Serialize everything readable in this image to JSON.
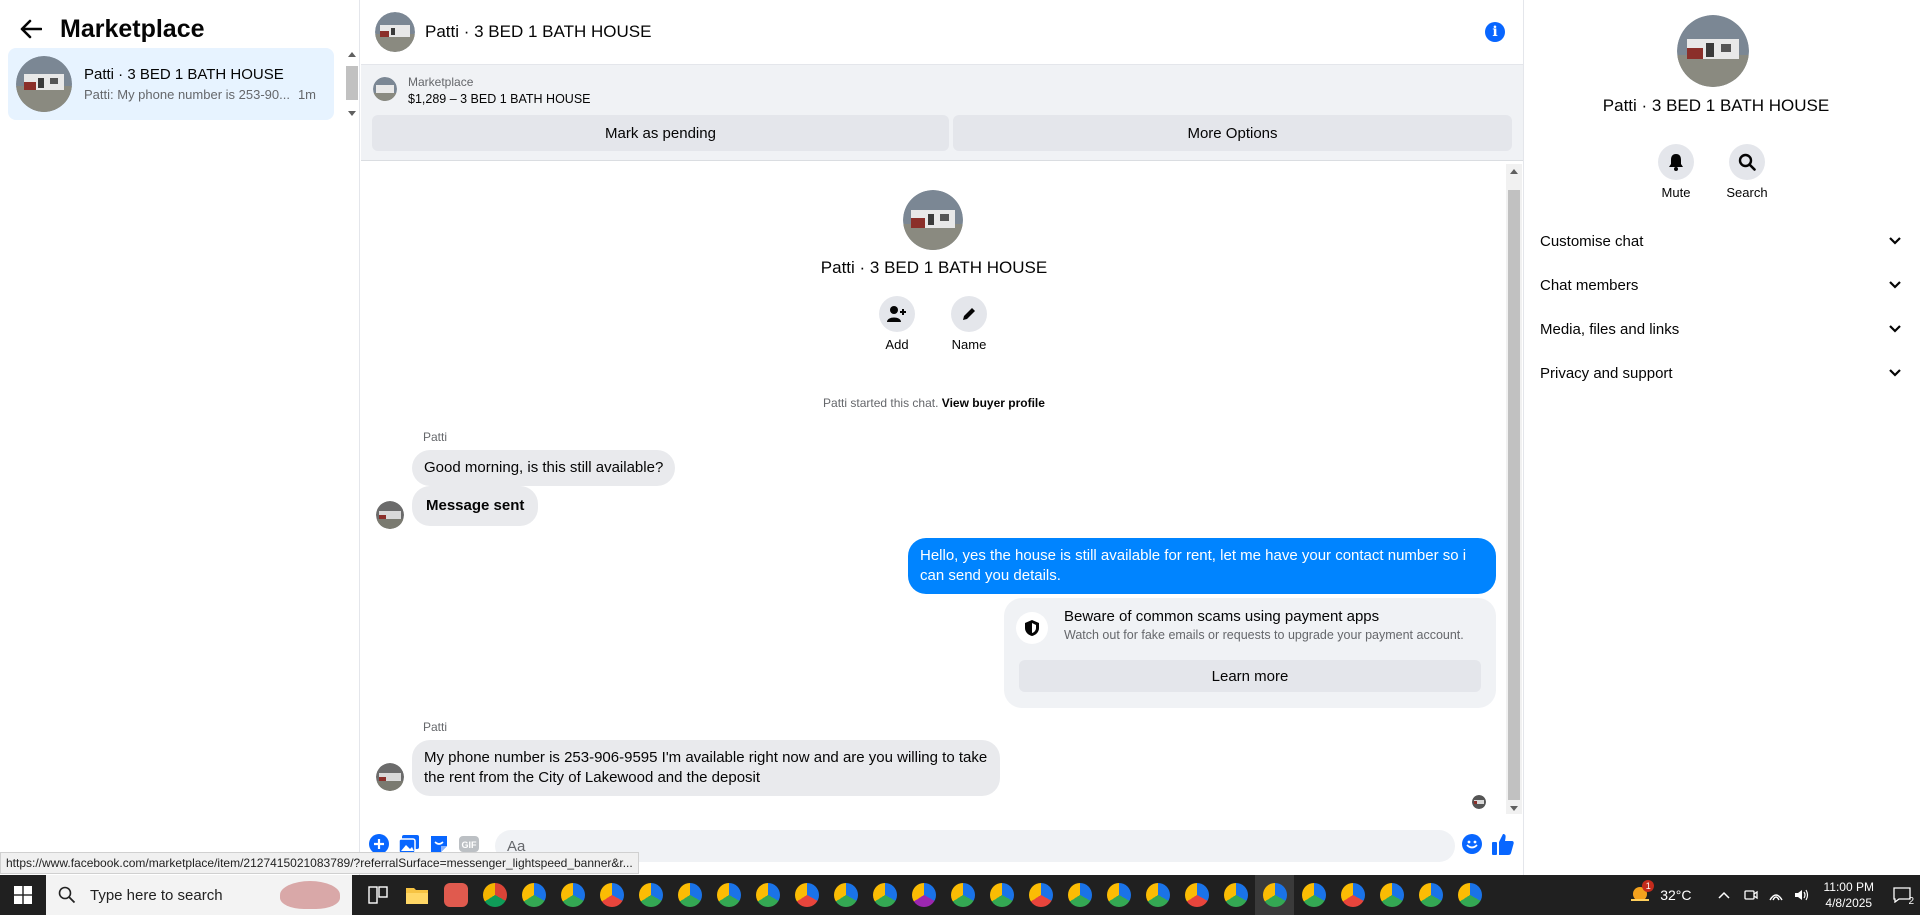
{
  "sidebar": {
    "title": "Marketplace",
    "conversation": {
      "name": "Patti · 3 BED 1 BATH HOUSE",
      "preview": "Patti: My phone number is 253-90...",
      "time": "1m"
    }
  },
  "chat": {
    "header_title": "Patti · 3 BED 1 BATH HOUSE",
    "listing_source": "Marketplace",
    "listing_title": "$1,289 – 3 BED 1 BATH HOUSE",
    "mark_pending": "Mark as pending",
    "more_options": "More Options",
    "profile_name": "Patti · 3 BED 1 BATH HOUSE",
    "add_label": "Add",
    "name_label": "Name",
    "started_text": "Patti started this chat.",
    "view_buyer_profile": "View buyer profile",
    "messages": [
      {
        "sender": "Patti",
        "text": "Good morning, is this still available?"
      },
      {
        "text": "Message sent"
      },
      {
        "text": "Hello, yes the house is still available for rent, let me have your contact number so i can send you details."
      },
      {
        "sender": "Patti",
        "text": "My phone number is 253-906-9595 I'm available right now and are you willing to take the rent from the City of Lakewood and the deposit"
      }
    ],
    "scam_title": "Beware of common scams using payment apps",
    "scam_sub": "Watch out for fake emails or requests to upgrade your payment account.",
    "learn_more": "Learn more",
    "composer_placeholder": "Aa"
  },
  "details": {
    "name": "Patti · 3 BED 1 BATH HOUSE",
    "mute_label": "Mute",
    "search_label": "Search",
    "sections": [
      "Customise chat",
      "Chat members",
      "Media, files and links",
      "Privacy and support"
    ]
  },
  "status_url": "https://www.facebook.com/marketplace/item/2127415021083789/?referralSurface=messenger_lightspeed_banner&r...",
  "taskbar": {
    "search_placeholder": "Type here to search",
    "temperature": "32°C",
    "time": "11:00 PM",
    "date": "4/8/2025",
    "weather_badge": "1",
    "notification_count": "2"
  },
  "colors": {
    "accent": "#0866ff",
    "outgoing_bubble": "#0084ff",
    "selected_conv": "#e7f3ff"
  }
}
